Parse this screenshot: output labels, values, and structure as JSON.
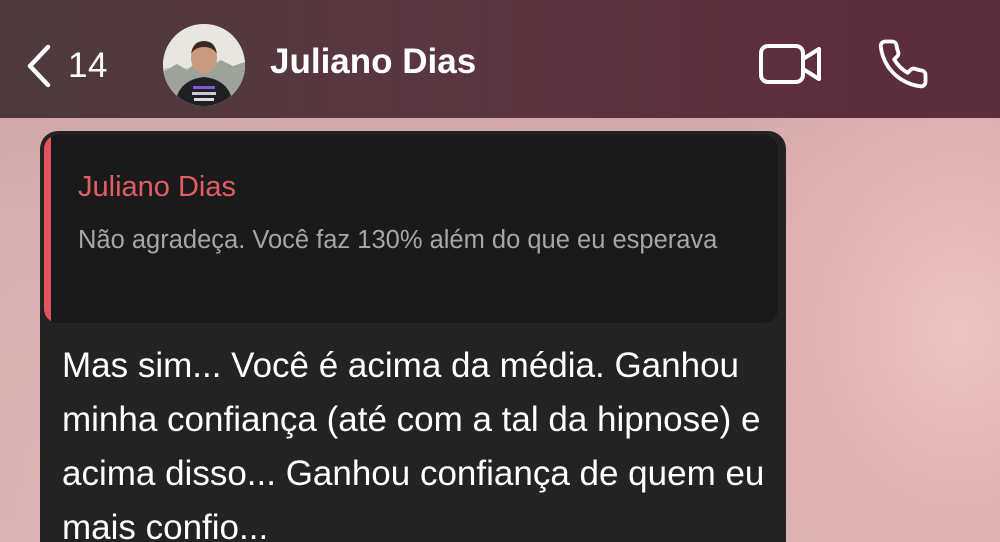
{
  "header": {
    "back_count": "14",
    "contact_name": "Juliano Dias",
    "icons": {
      "back": "chevron-left-icon",
      "video": "video-camera-icon",
      "call": "phone-icon"
    }
  },
  "message": {
    "reply": {
      "author": "Juliano Dias",
      "text": "Não agradeça. Você faz 130% além do que eu esperava"
    },
    "text": "Mas sim... Você é acima da média. Ganhou minha confiança (até com a tal da hipnose) e acima disso... Ganhou confiança de quem eu mais confio..."
  },
  "colors": {
    "header_bg": "#5a2e3c",
    "bubble_bg": "#232323",
    "quote_bg": "#1a1a1a",
    "accent_red": "#e0545f",
    "quote_text": "#a6a6a6"
  }
}
